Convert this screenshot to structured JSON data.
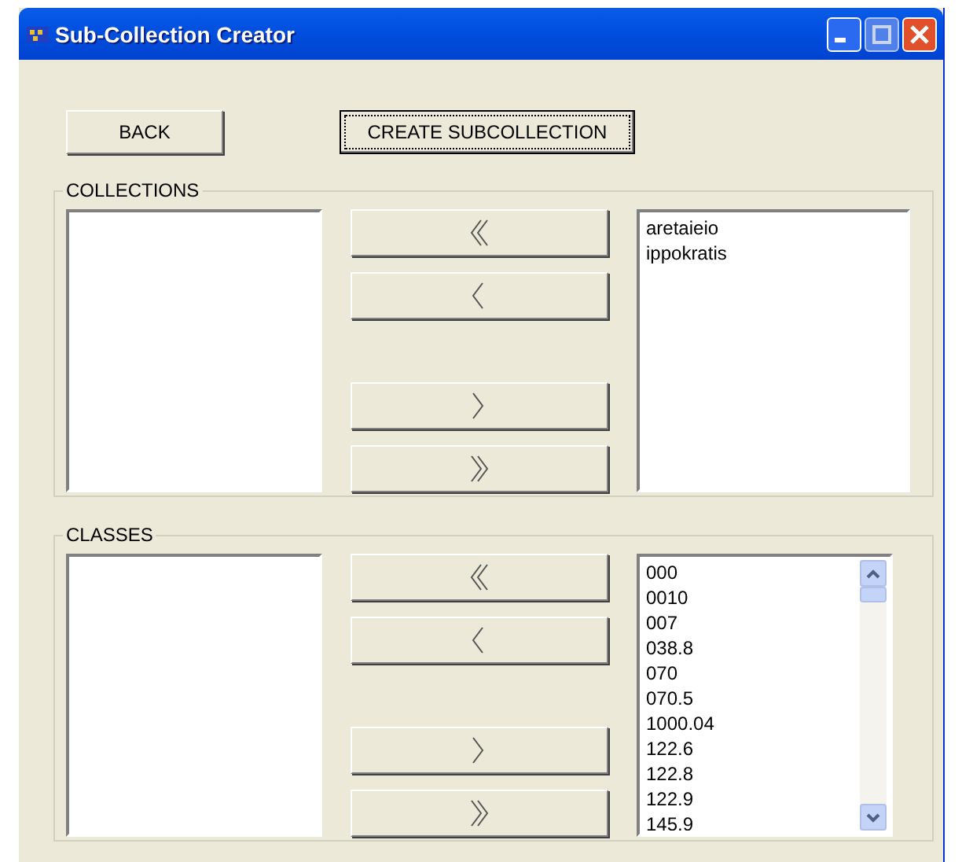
{
  "window": {
    "title": "Sub-Collection Creator"
  },
  "toolbar": [
    {
      "label": "BACK",
      "focused": false
    },
    {
      "label": "CREATE SUBCOLLECTION",
      "focused": true
    }
  ],
  "groups": [
    {
      "title": "COLLECTIONS",
      "scrollbar": false,
      "move_buttons": [
        {
          "kind": "all-left"
        },
        {
          "kind": "left"
        },
        {
          "kind": "right"
        },
        {
          "kind": "all-right"
        }
      ],
      "available": [
        "aretaieio",
        "ippokratis"
      ]
    },
    {
      "title": "CLASSES",
      "scrollbar": true,
      "move_buttons": [
        {
          "kind": "all-left"
        },
        {
          "kind": "left"
        },
        {
          "kind": "right"
        },
        {
          "kind": "all-right"
        }
      ],
      "available": [
        "000",
        "0010",
        "007",
        "038.8",
        "070",
        "070.5",
        "1000.04",
        "122.6",
        "122.8",
        "122.9",
        "145.9"
      ]
    }
  ]
}
